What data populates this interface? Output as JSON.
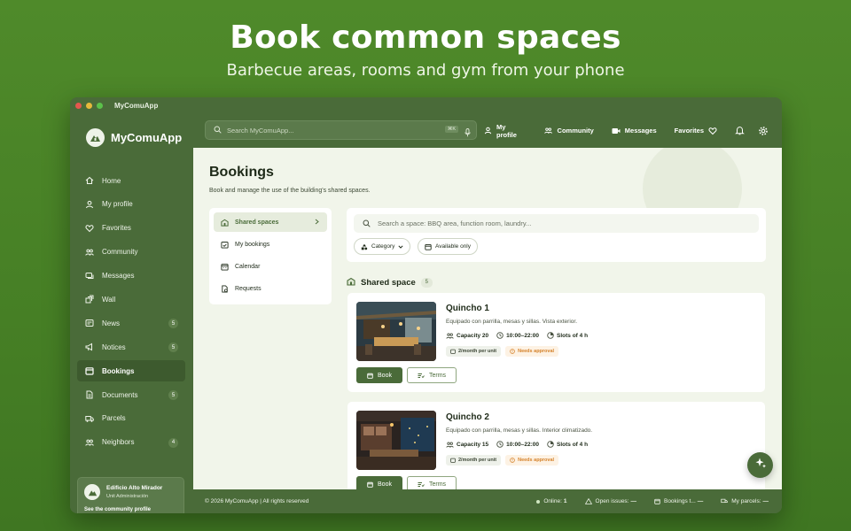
{
  "hero": {
    "title": "Book common spaces",
    "subtitle": "Barbecue areas, rooms and gym from your phone"
  },
  "window": {
    "title": "MyComuApp"
  },
  "sidebar": {
    "brand": "MyComuApp",
    "items": [
      {
        "label": "Home",
        "icon": "home-icon"
      },
      {
        "label": "My profile",
        "icon": "user-icon"
      },
      {
        "label": "Favorites",
        "icon": "heart-icon"
      },
      {
        "label": "Community",
        "icon": "users-icon"
      },
      {
        "label": "Messages",
        "icon": "messages-icon"
      },
      {
        "label": "Wall",
        "icon": "wall-icon"
      },
      {
        "label": "News",
        "icon": "news-icon",
        "badge": "5"
      },
      {
        "label": "Notices",
        "icon": "megaphone-icon",
        "badge": "5"
      },
      {
        "label": "Bookings",
        "icon": "calendar-icon",
        "active": true
      },
      {
        "label": "Documents",
        "icon": "document-icon",
        "badge": "5"
      },
      {
        "label": "Parcels",
        "icon": "truck-icon"
      },
      {
        "label": "Neighbors",
        "icon": "neighbors-icon",
        "badge": "4"
      }
    ],
    "community": {
      "name": "Edificio Alto Mirador",
      "role": "Unit Administración",
      "link": "See the community profile"
    }
  },
  "topbar": {
    "search_placeholder": "Search MyComuApp...",
    "shortcut": "⌘K",
    "links": {
      "profile": "My profile",
      "community": "Community",
      "messages": "Messages",
      "favorites": "Favorites"
    }
  },
  "page": {
    "title": "Bookings",
    "description": "Book and manage the use of the building's shared spaces."
  },
  "subnav": [
    {
      "label": "Shared spaces",
      "icon": "building-icon",
      "active": true
    },
    {
      "label": "My bookings",
      "icon": "calendar-check-icon"
    },
    {
      "label": "Calendar",
      "icon": "calendar-icon"
    },
    {
      "label": "Requests",
      "icon": "request-icon"
    }
  ],
  "filters": {
    "search_placeholder": "Search a space: BBQ area, function room, laundry...",
    "category": "Category",
    "available": "Available only"
  },
  "section": {
    "title": "Shared space",
    "count": "5"
  },
  "spaces": [
    {
      "name": "Quincho 1",
      "description": "Equipado con parrilla, mesas y sillas. Vista exterior.",
      "capacity": "Capacity 20",
      "hours": "10:00–22:00",
      "slots": "Slots of 4 h",
      "quota": "2/month per unit",
      "approval": "Needs approval",
      "book": "Book",
      "terms": "Terms"
    },
    {
      "name": "Quincho 2",
      "description": "Equipado con parrilla, mesas y sillas. Interior climatizado.",
      "capacity": "Capacity 15",
      "hours": "10:00–22:00",
      "slots": "Slots of 4 h",
      "quota": "2/month per unit",
      "approval": "Needs approval",
      "book": "Book",
      "terms": "Terms"
    }
  ],
  "footer": {
    "copyright": "© 2026 MyComuApp | All rights reserved",
    "online_label": "Online:",
    "online_value": "1",
    "issues_label": "Open issues:",
    "issues_value": "—",
    "bookings_label": "Bookings t...",
    "bookings_value": "—",
    "parcels_label": "My parcels:",
    "parcels_value": "—"
  },
  "colors": {
    "brand": "#4a6b39",
    "background": "#4f8a2a",
    "content": "#f1f5ea",
    "warning": "#d5822b"
  }
}
